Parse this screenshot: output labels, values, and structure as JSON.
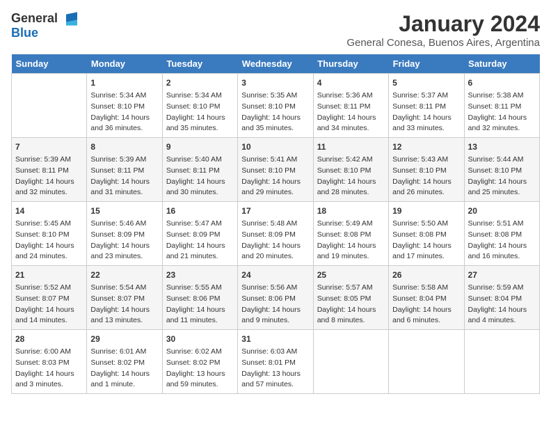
{
  "logo": {
    "general": "General",
    "blue": "Blue"
  },
  "title": "January 2024",
  "subtitle": "General Conesa, Buenos Aires, Argentina",
  "days_of_week": [
    "Sunday",
    "Monday",
    "Tuesday",
    "Wednesday",
    "Thursday",
    "Friday",
    "Saturday"
  ],
  "weeks": [
    [
      {
        "day": "",
        "info": ""
      },
      {
        "day": "1",
        "info": "Sunrise: 5:34 AM\nSunset: 8:10 PM\nDaylight: 14 hours\nand 36 minutes."
      },
      {
        "day": "2",
        "info": "Sunrise: 5:34 AM\nSunset: 8:10 PM\nDaylight: 14 hours\nand 35 minutes."
      },
      {
        "day": "3",
        "info": "Sunrise: 5:35 AM\nSunset: 8:10 PM\nDaylight: 14 hours\nand 35 minutes."
      },
      {
        "day": "4",
        "info": "Sunrise: 5:36 AM\nSunset: 8:11 PM\nDaylight: 14 hours\nand 34 minutes."
      },
      {
        "day": "5",
        "info": "Sunrise: 5:37 AM\nSunset: 8:11 PM\nDaylight: 14 hours\nand 33 minutes."
      },
      {
        "day": "6",
        "info": "Sunrise: 5:38 AM\nSunset: 8:11 PM\nDaylight: 14 hours\nand 32 minutes."
      }
    ],
    [
      {
        "day": "7",
        "info": "Sunrise: 5:39 AM\nSunset: 8:11 PM\nDaylight: 14 hours\nand 32 minutes."
      },
      {
        "day": "8",
        "info": "Sunrise: 5:39 AM\nSunset: 8:11 PM\nDaylight: 14 hours\nand 31 minutes."
      },
      {
        "day": "9",
        "info": "Sunrise: 5:40 AM\nSunset: 8:11 PM\nDaylight: 14 hours\nand 30 minutes."
      },
      {
        "day": "10",
        "info": "Sunrise: 5:41 AM\nSunset: 8:10 PM\nDaylight: 14 hours\nand 29 minutes."
      },
      {
        "day": "11",
        "info": "Sunrise: 5:42 AM\nSunset: 8:10 PM\nDaylight: 14 hours\nand 28 minutes."
      },
      {
        "day": "12",
        "info": "Sunrise: 5:43 AM\nSunset: 8:10 PM\nDaylight: 14 hours\nand 26 minutes."
      },
      {
        "day": "13",
        "info": "Sunrise: 5:44 AM\nSunset: 8:10 PM\nDaylight: 14 hours\nand 25 minutes."
      }
    ],
    [
      {
        "day": "14",
        "info": "Sunrise: 5:45 AM\nSunset: 8:10 PM\nDaylight: 14 hours\nand 24 minutes."
      },
      {
        "day": "15",
        "info": "Sunrise: 5:46 AM\nSunset: 8:09 PM\nDaylight: 14 hours\nand 23 minutes."
      },
      {
        "day": "16",
        "info": "Sunrise: 5:47 AM\nSunset: 8:09 PM\nDaylight: 14 hours\nand 21 minutes."
      },
      {
        "day": "17",
        "info": "Sunrise: 5:48 AM\nSunset: 8:09 PM\nDaylight: 14 hours\nand 20 minutes."
      },
      {
        "day": "18",
        "info": "Sunrise: 5:49 AM\nSunset: 8:08 PM\nDaylight: 14 hours\nand 19 minutes."
      },
      {
        "day": "19",
        "info": "Sunrise: 5:50 AM\nSunset: 8:08 PM\nDaylight: 14 hours\nand 17 minutes."
      },
      {
        "day": "20",
        "info": "Sunrise: 5:51 AM\nSunset: 8:08 PM\nDaylight: 14 hours\nand 16 minutes."
      }
    ],
    [
      {
        "day": "21",
        "info": "Sunrise: 5:52 AM\nSunset: 8:07 PM\nDaylight: 14 hours\nand 14 minutes."
      },
      {
        "day": "22",
        "info": "Sunrise: 5:54 AM\nSunset: 8:07 PM\nDaylight: 14 hours\nand 13 minutes."
      },
      {
        "day": "23",
        "info": "Sunrise: 5:55 AM\nSunset: 8:06 PM\nDaylight: 14 hours\nand 11 minutes."
      },
      {
        "day": "24",
        "info": "Sunrise: 5:56 AM\nSunset: 8:06 PM\nDaylight: 14 hours\nand 9 minutes."
      },
      {
        "day": "25",
        "info": "Sunrise: 5:57 AM\nSunset: 8:05 PM\nDaylight: 14 hours\nand 8 minutes."
      },
      {
        "day": "26",
        "info": "Sunrise: 5:58 AM\nSunset: 8:04 PM\nDaylight: 14 hours\nand 6 minutes."
      },
      {
        "day": "27",
        "info": "Sunrise: 5:59 AM\nSunset: 8:04 PM\nDaylight: 14 hours\nand 4 minutes."
      }
    ],
    [
      {
        "day": "28",
        "info": "Sunrise: 6:00 AM\nSunset: 8:03 PM\nDaylight: 14 hours\nand 3 minutes."
      },
      {
        "day": "29",
        "info": "Sunrise: 6:01 AM\nSunset: 8:02 PM\nDaylight: 14 hours\nand 1 minute."
      },
      {
        "day": "30",
        "info": "Sunrise: 6:02 AM\nSunset: 8:02 PM\nDaylight: 13 hours\nand 59 minutes."
      },
      {
        "day": "31",
        "info": "Sunrise: 6:03 AM\nSunset: 8:01 PM\nDaylight: 13 hours\nand 57 minutes."
      },
      {
        "day": "",
        "info": ""
      },
      {
        "day": "",
        "info": ""
      },
      {
        "day": "",
        "info": ""
      }
    ]
  ]
}
